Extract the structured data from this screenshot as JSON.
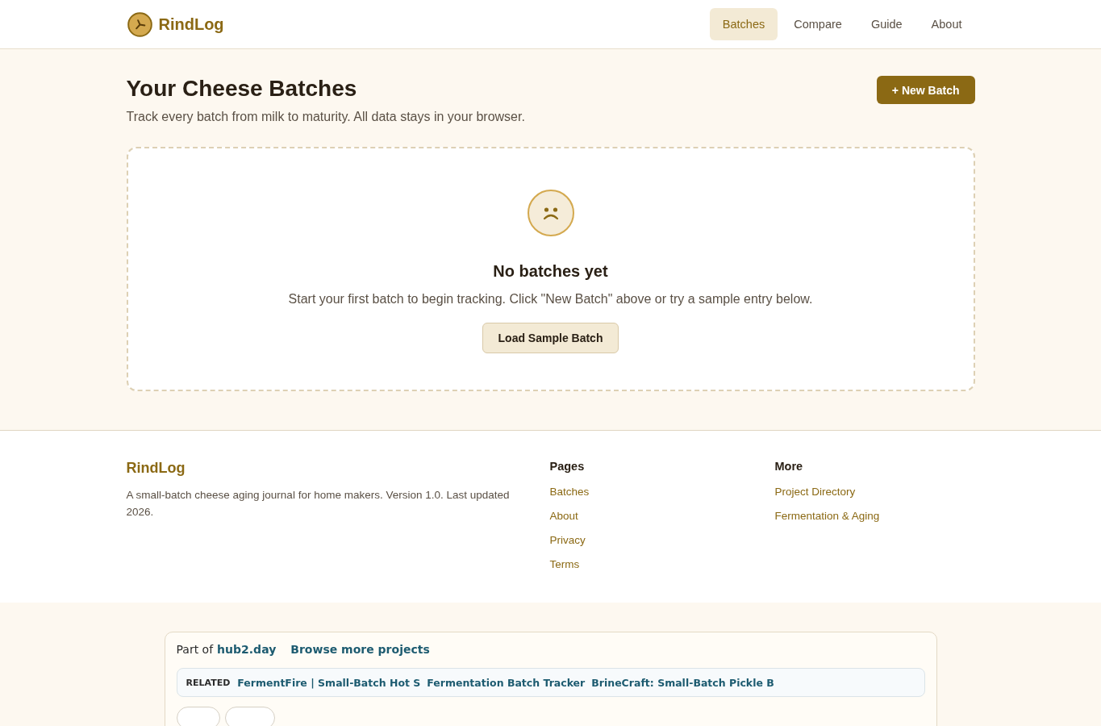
{
  "header": {
    "brand": "RindLog",
    "nav": [
      {
        "label": "Batches",
        "selected": true
      },
      {
        "label": "Compare",
        "selected": false
      },
      {
        "label": "Guide",
        "selected": false
      },
      {
        "label": "About",
        "selected": false
      }
    ]
  },
  "page": {
    "title": "Your Cheese Batches",
    "subtitle": "Track every batch from milk to maturity. All data stays in your browser.",
    "new_button": "+ New Batch"
  },
  "empty_state": {
    "title": "No batches yet",
    "message": "Start your first batch to begin tracking. Click \"New Batch\" above or try a sample entry below.",
    "button": "Load Sample Batch"
  },
  "footer": {
    "brand": "RindLog",
    "description": "A small-batch cheese aging journal for home makers. Version 1.0. Last updated 2026.",
    "columns": [
      {
        "heading": "Pages",
        "links": [
          "Batches",
          "About",
          "Privacy",
          "Terms"
        ]
      },
      {
        "heading": "More",
        "links": [
          "Project Directory",
          "Fermentation & Aging"
        ]
      }
    ]
  },
  "hub": {
    "prefix": "Part of",
    "site": "hub2.day",
    "browse": "Browse more projects",
    "related_label": "RELATED",
    "related": [
      "FermentFire | Small-Batch Hot S",
      "Fermentation Batch Tracker",
      "BrineCraft: Small-Batch Pickle B"
    ]
  }
}
